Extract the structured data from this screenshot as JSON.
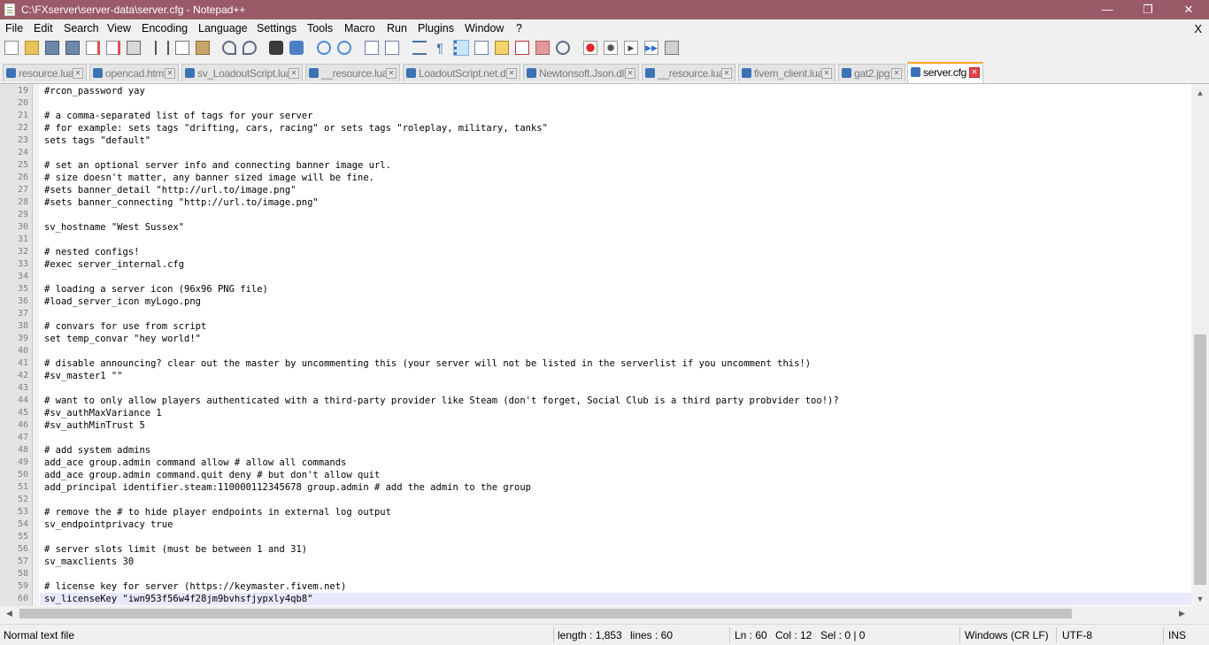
{
  "window": {
    "title": "C:\\FXserver\\server-data\\server.cfg - Notepad++",
    "minimize": "—",
    "maximize": "❐",
    "close": "✕"
  },
  "menu": {
    "items": [
      "File",
      "Edit",
      "Search",
      "View",
      "Encoding",
      "Language",
      "Settings",
      "Tools",
      "Macro",
      "Run",
      "Plugins",
      "Window",
      "?"
    ],
    "close": "X"
  },
  "toolbar": {
    "icons": [
      "new-file-icon",
      "open-file-icon",
      "save-icon",
      "save-all-icon",
      "close-icon",
      "close-all-icon",
      "print-icon",
      "cut-icon",
      "copy-icon",
      "paste-icon",
      "undo-icon",
      "redo-icon",
      "find-icon",
      "replace-icon",
      "zoom-in-icon",
      "zoom-out-icon",
      "sync-vertical-icon",
      "sync-horizontal-icon",
      "word-wrap-icon",
      "show-all-chars-icon",
      "indent-guide-icon",
      "user-defined-language-icon",
      "document-map-icon",
      "function-list-icon",
      "folder-workspace-icon",
      "monitoring-icon",
      "record-macro-icon",
      "stop-recording-icon",
      "playback-macro-icon",
      "run-macro-multiple-icon",
      "save-macro-icon"
    ]
  },
  "tabs": [
    {
      "label": "resource.lua",
      "active": false
    },
    {
      "label": "opencad.html",
      "active": false
    },
    {
      "label": "sv_LoadoutScript.lua",
      "active": false
    },
    {
      "label": "__resource.lua",
      "active": false
    },
    {
      "label": "LoadoutScript.net.dll",
      "active": false
    },
    {
      "label": "Newtonsoft.Json.dll",
      "active": false
    },
    {
      "label": "__resource.lua",
      "active": false
    },
    {
      "label": "fivem_client.lua",
      "active": false
    },
    {
      "label": "gat2.jpg",
      "active": false
    },
    {
      "label": "server.cfg",
      "active": true
    }
  ],
  "editor": {
    "lines": [
      {
        "n": "19",
        "text": "#rcon_password yay"
      },
      {
        "n": "20",
        "text": ""
      },
      {
        "n": "21",
        "text": "# a comma-separated list of tags for your server"
      },
      {
        "n": "22",
        "text": "# for example: sets tags \"drifting, cars, racing\" or sets tags \"roleplay, military, tanks\""
      },
      {
        "n": "23",
        "text": "sets tags \"default\""
      },
      {
        "n": "24",
        "text": ""
      },
      {
        "n": "25",
        "text": "# set an optional server info and connecting banner image url."
      },
      {
        "n": "26",
        "text": "# size doesn't matter, any banner sized image will be fine."
      },
      {
        "n": "27",
        "text": "#sets banner_detail \"http://url.to/image.png\""
      },
      {
        "n": "28",
        "text": "#sets banner_connecting \"http://url.to/image.png\""
      },
      {
        "n": "29",
        "text": ""
      },
      {
        "n": "30",
        "text": "sv_hostname \"West Sussex\""
      },
      {
        "n": "31",
        "text": ""
      },
      {
        "n": "32",
        "text": "# nested configs!"
      },
      {
        "n": "33",
        "text": "#exec server_internal.cfg"
      },
      {
        "n": "34",
        "text": ""
      },
      {
        "n": "35",
        "text": "# loading a server icon (96x96 PNG file)"
      },
      {
        "n": "36",
        "text": "#load_server_icon myLogo.png"
      },
      {
        "n": "37",
        "text": ""
      },
      {
        "n": "38",
        "text": "# convars for use from script"
      },
      {
        "n": "39",
        "text": "set temp_convar \"hey world!\""
      },
      {
        "n": "40",
        "text": ""
      },
      {
        "n": "41",
        "text": "# disable announcing? clear out the master by uncommenting this (your server will not be listed in the serverlist if you uncomment this!)"
      },
      {
        "n": "42",
        "text": "#sv_master1 \"\""
      },
      {
        "n": "43",
        "text": ""
      },
      {
        "n": "44",
        "text": "# want to only allow players authenticated with a third-party provider like Steam (don't forget, Social Club is a third party probvider too!)?"
      },
      {
        "n": "45",
        "text": "#sv_authMaxVariance 1"
      },
      {
        "n": "46",
        "text": "#sv_authMinTrust 5"
      },
      {
        "n": "47",
        "text": ""
      },
      {
        "n": "48",
        "text": "# add system admins"
      },
      {
        "n": "49",
        "text": "add_ace group.admin command allow # allow all commands"
      },
      {
        "n": "50",
        "text": "add_ace group.admin command.quit deny # but don't allow quit"
      },
      {
        "n": "51",
        "text": "add_principal identifier.steam:110000112345678 group.admin # add the admin to the group"
      },
      {
        "n": "52",
        "text": ""
      },
      {
        "n": "53",
        "text": "# remove the # to hide player endpoints in external log output"
      },
      {
        "n": "54",
        "text": "sv_endpointprivacy true"
      },
      {
        "n": "55",
        "text": ""
      },
      {
        "n": "56",
        "text": "# server slots limit (must be between 1 and 31)"
      },
      {
        "n": "57",
        "text": "sv_maxclients 30"
      },
      {
        "n": "58",
        "text": ""
      },
      {
        "n": "59",
        "text": "# license key for server (https://keymaster.fivem.net)"
      },
      {
        "n": "60",
        "text": "sv_licenseKey \"iwn953f56w4f28jm9bvhsfjypxly4qb8\""
      }
    ],
    "current_line": "60"
  },
  "status": {
    "file_type": "Normal text file",
    "length": "length : 1,853",
    "lines": "lines : 60",
    "ln": "Ln : 60",
    "col": "Col : 12",
    "sel": "Sel : 0 | 0",
    "eol": "Windows (CR LF)",
    "encoding": "UTF-8",
    "mode": "INS"
  },
  "colors": {
    "titlebar": "#9b5a68",
    "active_tab_accent": "#f9a825",
    "current_line": "#e8e8ff",
    "tab_close_active": "#e0464e"
  }
}
